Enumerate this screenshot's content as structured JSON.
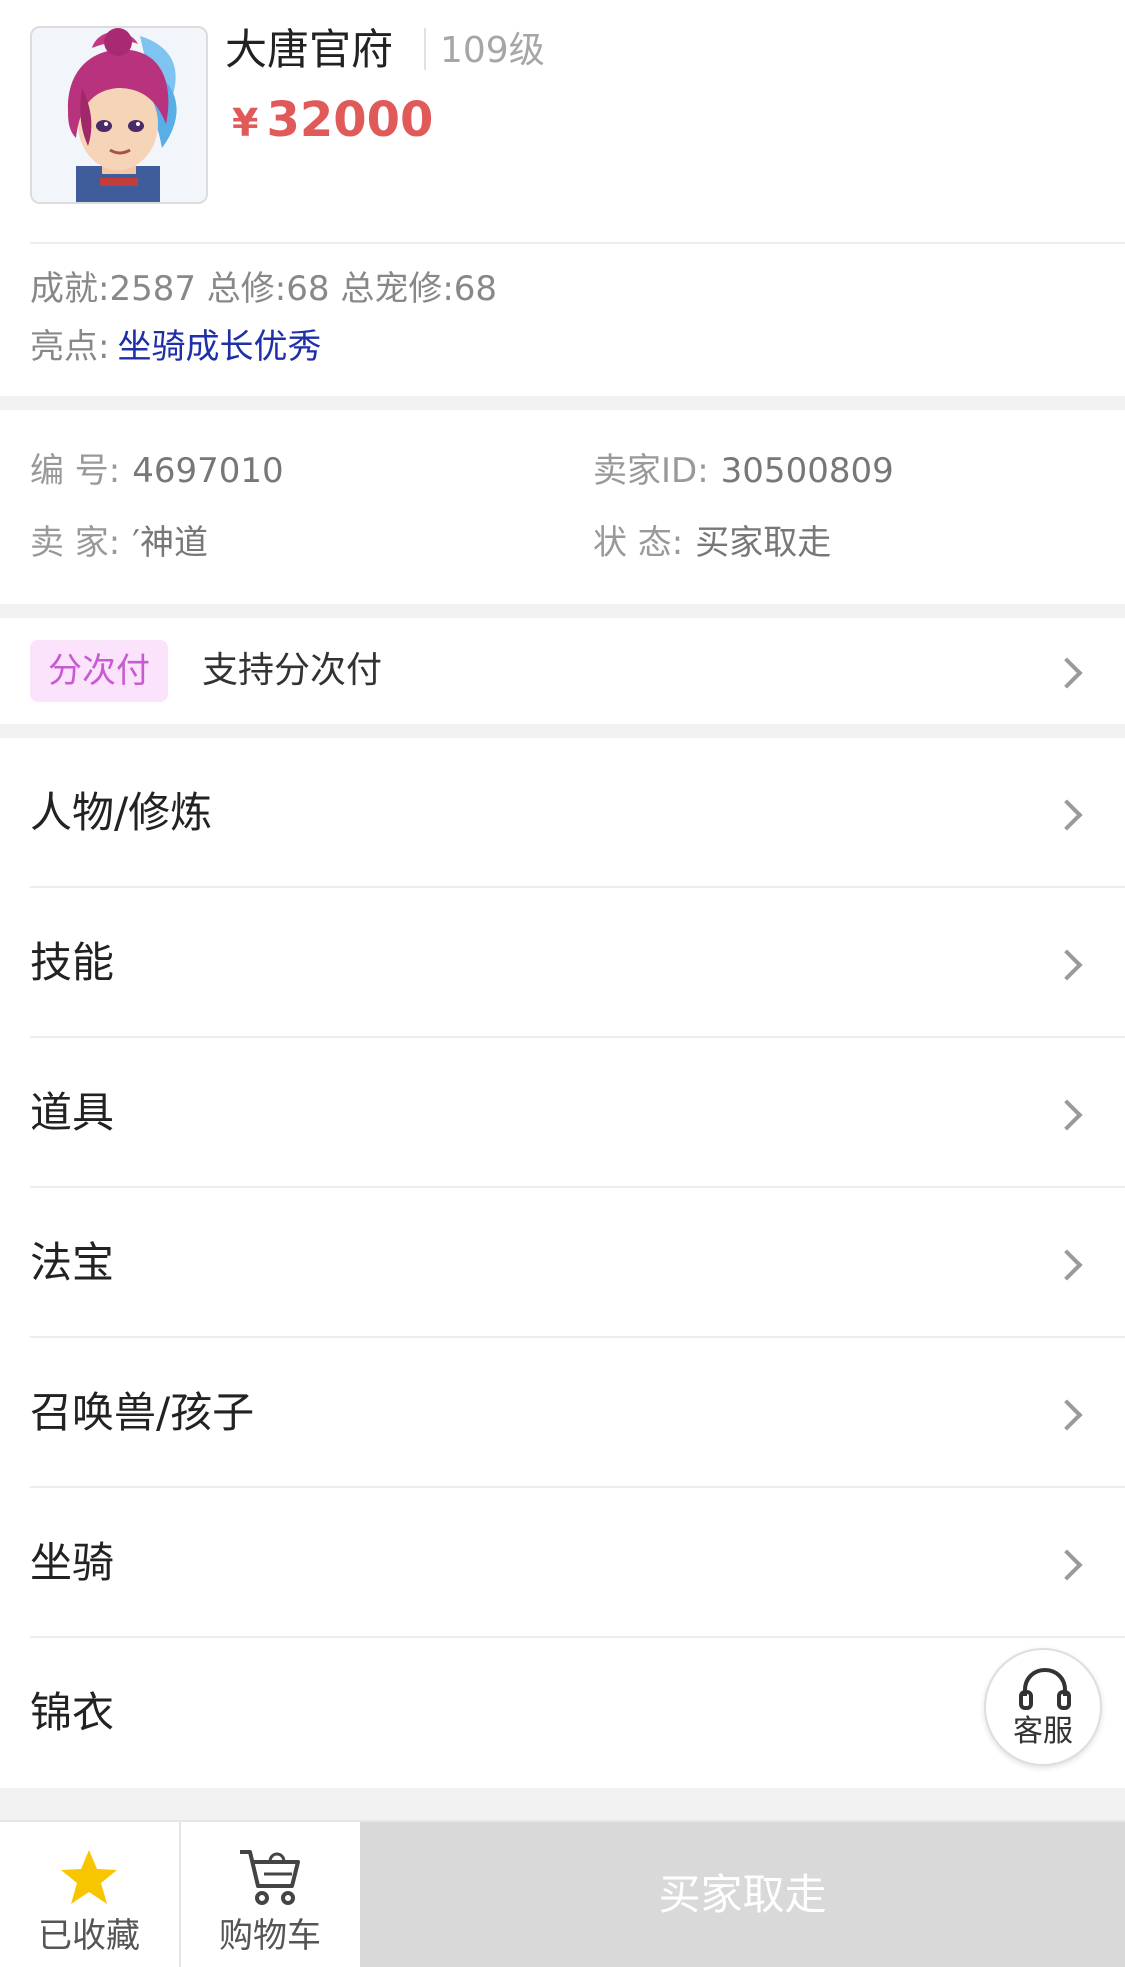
{
  "header": {
    "role_name": "大唐官府",
    "level": "109级",
    "price_currency": "¥",
    "price_value": "32000"
  },
  "stats": {
    "text": "成就:2587 总修:68 总宠修:68",
    "highlight_label": "亮点:",
    "highlight_value": "坐骑成长优秀"
  },
  "info": {
    "id_label": "编 号:",
    "id_value": "4697010",
    "seller_id_label": "卖家ID:",
    "seller_id_value": "30500809",
    "seller_label": "卖 家:",
    "seller_value": "′神道",
    "status_label": "状 态:",
    "status_value": "买家取走"
  },
  "installment": {
    "tag": "分次付",
    "text": "支持分次付"
  },
  "menu": [
    {
      "label": "人物/修炼"
    },
    {
      "label": "技能"
    },
    {
      "label": "道具"
    },
    {
      "label": "法宝"
    },
    {
      "label": "召唤兽/孩子"
    },
    {
      "label": "坐骑"
    },
    {
      "label": "锦衣"
    }
  ],
  "service": {
    "label": "客服",
    "icon": "headset-icon"
  },
  "bottom": {
    "favorite_label": "已收藏",
    "favorite_icon": "star-icon",
    "cart_label": "购物车",
    "cart_icon": "cart-icon",
    "buy_label": "买家取走"
  },
  "colors": {
    "price": "#e05a5a",
    "highlight": "#1e2fa8",
    "tag_bg": "#fbe3fb",
    "tag_text": "#c85ad2",
    "star": "#f7c600",
    "disabled_button": "#d9d9d9"
  }
}
